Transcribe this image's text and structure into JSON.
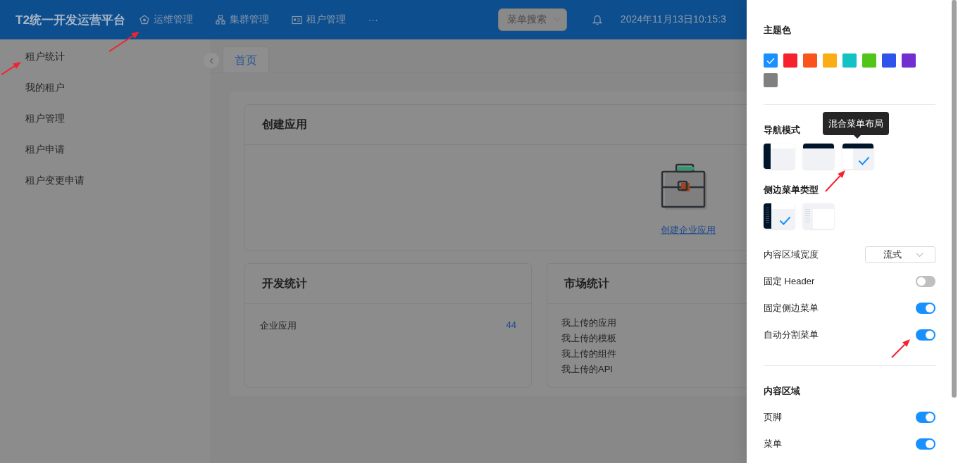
{
  "header": {
    "title": "T2统一开发运营平台",
    "nav": [
      {
        "label": "运维管理"
      },
      {
        "label": "集群管理"
      },
      {
        "label": "租户管理"
      }
    ],
    "more": "···",
    "search": {
      "placeholder": "菜单搜索"
    },
    "datetime": "2024年11月13日10:15:3"
  },
  "sidebar": {
    "items": [
      {
        "label": "租户统计"
      },
      {
        "label": "我的租户"
      },
      {
        "label": "租户管理"
      },
      {
        "label": "租户申请"
      },
      {
        "label": "租户变更申请"
      }
    ]
  },
  "tabs": [
    {
      "label": "首页",
      "selected": true
    }
  ],
  "create_app": {
    "title": "创建应用",
    "link": "创建企业应用"
  },
  "dev_stats": {
    "title": "开发统计",
    "rows": [
      {
        "label": "企业应用",
        "value": "44"
      }
    ]
  },
  "market_stats": {
    "title": "市场统计",
    "items": [
      "我上传的应用",
      "我上传的模板",
      "我上传的组件",
      "我上传的API"
    ]
  },
  "settings": {
    "theme_title": "主题色",
    "theme_colors": [
      {
        "color": "#1890ff",
        "selected": true
      },
      {
        "color": "#f5222d",
        "selected": false
      },
      {
        "color": "#fa541c",
        "selected": false
      },
      {
        "color": "#faad14",
        "selected": false
      },
      {
        "color": "#13c2c2",
        "selected": false
      },
      {
        "color": "#52c41a",
        "selected": false
      },
      {
        "color": "#2f54eb",
        "selected": false
      },
      {
        "color": "#722ed1",
        "selected": false
      },
      {
        "color": "#808080",
        "selected": false
      }
    ],
    "nav_mode": {
      "title": "导航模式",
      "tooltip": "混合菜单布局",
      "options": [
        {
          "kind": "side",
          "selected": false
        },
        {
          "kind": "top",
          "selected": false
        },
        {
          "kind": "mix",
          "selected": true
        }
      ]
    },
    "side_menu_type": {
      "title": "侧边菜单类型",
      "options": [
        {
          "kind": "dark",
          "selected": true
        },
        {
          "kind": "light",
          "selected": false
        }
      ]
    },
    "content_width": {
      "label": "内容区域宽度",
      "value": "流式"
    },
    "toggles": [
      {
        "label": "固定 Header",
        "on": false
      },
      {
        "label": "固定侧边菜单",
        "on": true
      },
      {
        "label": "自动分割菜单",
        "on": true
      }
    ],
    "content_area": {
      "title": "内容区域",
      "toggles": [
        {
          "label": "页脚",
          "on": true
        },
        {
          "label": "菜单",
          "on": true
        }
      ]
    }
  },
  "annotations": [
    {
      "kind": "arrow"
    },
    {
      "kind": "arrow"
    },
    {
      "kind": "arrow"
    },
    {
      "kind": "arrow"
    }
  ]
}
